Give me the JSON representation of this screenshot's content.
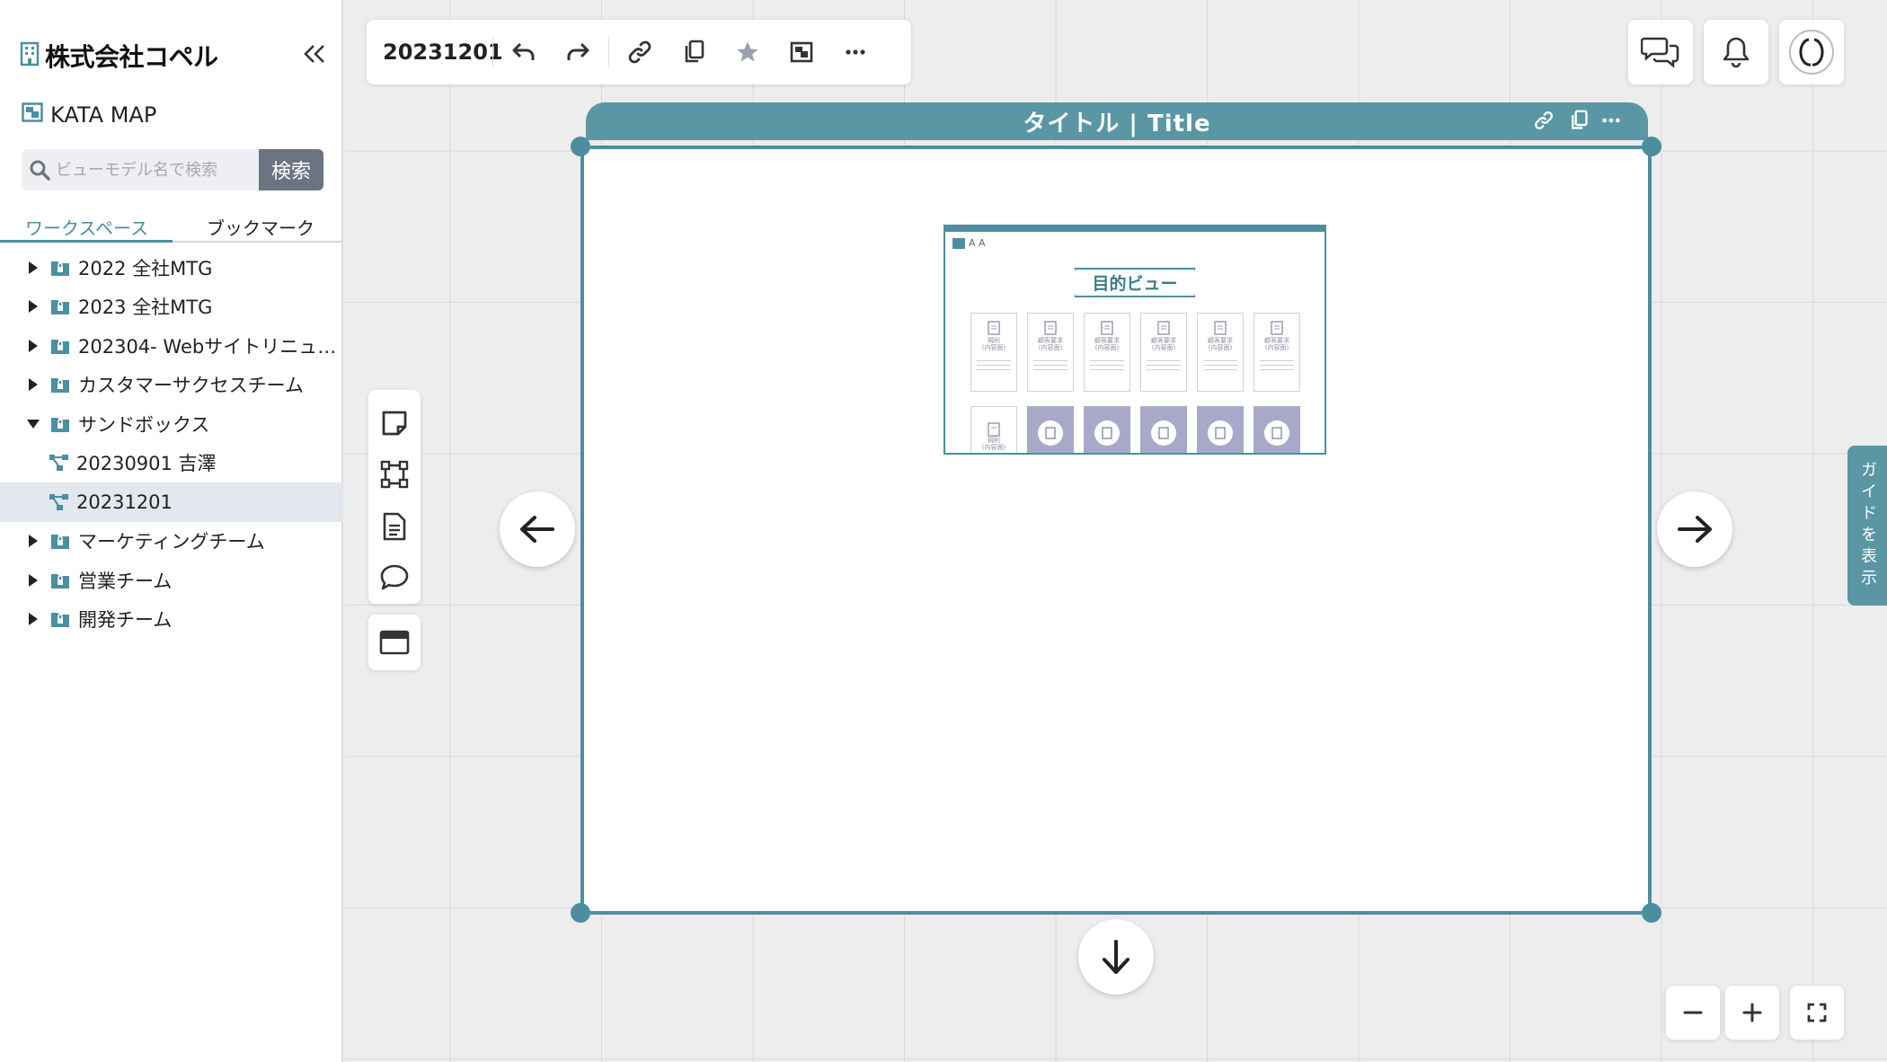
{
  "sidebar": {
    "org_name": "株式会社コペル",
    "map_label": "KATA MAP",
    "search": {
      "placeholder": "ビューモデル名で検索",
      "value": "",
      "button_label": "検索"
    },
    "tabs": [
      {
        "label": "ワークスペース",
        "active": true
      },
      {
        "label": "ブックマーク",
        "active": false
      }
    ],
    "tree": [
      {
        "label": "2022 全社MTG",
        "type": "folder",
        "expanded": false
      },
      {
        "label": "2023 全社MTG",
        "type": "folder",
        "expanded": false
      },
      {
        "label": "202304- Webサイトリニュ…",
        "type": "folder",
        "expanded": false
      },
      {
        "label": "カスタマーサクセスチーム",
        "type": "folder",
        "expanded": false
      },
      {
        "label": "サンドボックス",
        "type": "folder",
        "expanded": true
      },
      {
        "label": "20230901 吉澤",
        "type": "view"
      },
      {
        "label": "20231201",
        "type": "view",
        "selected": true
      },
      {
        "label": "マーケティングチーム",
        "type": "folder",
        "expanded": false
      },
      {
        "label": "営業チーム",
        "type": "folder",
        "expanded": false
      },
      {
        "label": "開発チーム",
        "type": "folder",
        "expanded": false
      }
    ]
  },
  "toolbar": {
    "doc_title": "20231201",
    "buttons": [
      "undo-icon",
      "redo-icon",
      "link-icon",
      "copy-icon",
      "star-icon",
      "image-icon",
      "more-icon"
    ]
  },
  "frame": {
    "title": "タイトル | Title",
    "thumbnail": {
      "tools": "A A",
      "title": "目的ビュー",
      "card_labels": [
        "規則\n(内容面)",
        "顧客要求\n(内容面)",
        "顧客要求\n(内容面)",
        "顧客要求\n(内容面)",
        "顧客要求\n(内容面)",
        "顧客要求\n(内容面)"
      ],
      "card2_label": "規則\n(内容面)"
    }
  },
  "guide_tab": {
    "label": "ガイドを表示"
  },
  "colors": {
    "accent": "#5a96a4",
    "frame_border": "#4d8e9e",
    "selected_bg": "#e3e7ee",
    "search_btn": "#6b7480"
  }
}
